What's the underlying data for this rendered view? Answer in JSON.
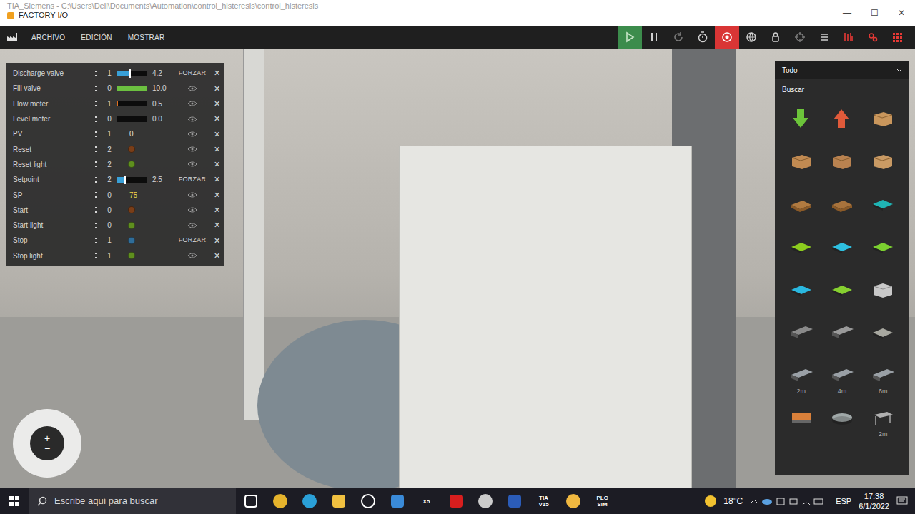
{
  "window": {
    "path": "TIA_Siemens - C:\\Users\\Dell\\Documents\\Automation\\control_histeresis\\control_histeresis",
    "title": "FACTORY I/O",
    "controls": [
      "—",
      "☐",
      "✕"
    ]
  },
  "menu": [
    "ARCHIVO",
    "EDICIÓN",
    "MOSTRAR"
  ],
  "toolbar": [
    {
      "kind": "play",
      "active": true,
      "color": "#c8e6c9"
    },
    {
      "kind": "pause",
      "active": false,
      "color": "#d0d0d0"
    },
    {
      "kind": "reset",
      "active": false,
      "color": "#7a7a7a"
    },
    {
      "kind": "timer",
      "active": false,
      "color": "#d0d0d0"
    },
    {
      "kind": "camera",
      "active": true,
      "color": "#ffffff"
    },
    {
      "kind": "globe",
      "active": false,
      "color": "#d0d0d0"
    },
    {
      "kind": "lock",
      "active": false,
      "color": "#d0d0d0"
    },
    {
      "kind": "target",
      "active": false,
      "color": "#7a7a7a"
    },
    {
      "kind": "list",
      "active": false,
      "color": "#d0d0d0"
    },
    {
      "kind": "sensors",
      "active": false,
      "color": "#e53935"
    },
    {
      "kind": "gears",
      "active": false,
      "color": "#e53935"
    },
    {
      "kind": "grid",
      "active": false,
      "color": "#e53935"
    }
  ],
  "tags": [
    {
      "name": "Discharge valve",
      "value": "1",
      "kind": "slider",
      "level": 0.42,
      "reading": "4.2",
      "action": {
        "kind": "force",
        "label": "FORZAR"
      },
      "remove": "✕"
    },
    {
      "name": "Fill valve",
      "value": "0",
      "kind": "bar",
      "level": 1.0,
      "reading": "10.0",
      "color": "#6cc040",
      "action": {
        "kind": "view"
      },
      "remove": "✕"
    },
    {
      "name": "Flow meter",
      "value": "1",
      "kind": "bar",
      "level": 0.05,
      "reading": "0.5",
      "color": "#e07020",
      "action": {
        "kind": "view"
      },
      "remove": "✕"
    },
    {
      "name": "Level meter",
      "value": "0",
      "kind": "bar",
      "level": 0.0,
      "reading": "0.0",
      "color": "#e07020",
      "action": {
        "kind": "view"
      },
      "remove": "✕"
    },
    {
      "name": "PV",
      "value": "1",
      "kind": "number",
      "reading": "0",
      "color": "#e0e0e0",
      "action": {
        "kind": "view"
      },
      "remove": "✕"
    },
    {
      "name": "Reset",
      "value": "2",
      "kind": "dot",
      "color": "#7a3e18",
      "action": {
        "kind": "view"
      },
      "remove": "✕"
    },
    {
      "name": "Reset light",
      "value": "2",
      "kind": "dot",
      "color": "#5f8f1e",
      "action": {
        "kind": "view"
      },
      "remove": "✕"
    },
    {
      "name": "Setpoint",
      "value": "2",
      "kind": "slider",
      "level": 0.25,
      "reading": "2.5",
      "action": {
        "kind": "force",
        "label": "FORZAR"
      },
      "remove": "✕"
    },
    {
      "name": "SP",
      "value": "0",
      "kind": "number",
      "reading": "75",
      "color": "#e8d44a",
      "action": {
        "kind": "view"
      },
      "remove": "✕"
    },
    {
      "name": "Start",
      "value": "0",
      "kind": "dot",
      "color": "#7a3e18",
      "action": {
        "kind": "view"
      },
      "remove": "✕"
    },
    {
      "name": "Start light",
      "value": "0",
      "kind": "dot",
      "color": "#5f8f1e",
      "action": {
        "kind": "view"
      },
      "remove": "✕"
    },
    {
      "name": "Stop",
      "value": "1",
      "kind": "dot",
      "color": "#2f6d99",
      "action": {
        "kind": "force",
        "label": "FORZAR"
      },
      "remove": "✕"
    },
    {
      "name": "Stop light",
      "value": "1",
      "kind": "dot",
      "color": "#5f8f1e",
      "action": {
        "kind": "view"
      },
      "remove": "✕"
    }
  ],
  "nav": {
    "plus": "+",
    "minus": "−"
  },
  "library": {
    "filter": "Todo",
    "search": "Buscar",
    "items": [
      {
        "kind": "arrow-down",
        "color": "#6cc43a"
      },
      {
        "kind": "arrow-up",
        "color": "#e05a3a"
      },
      {
        "kind": "box",
        "color": "#c9965c"
      },
      {
        "kind": "box",
        "color": "#c18a52"
      },
      {
        "kind": "box",
        "color": "#b98250"
      },
      {
        "kind": "box",
        "color": "#c99a64"
      },
      {
        "kind": "pallet",
        "color": "#b07a40"
      },
      {
        "kind": "pallet",
        "color": "#a8733c"
      },
      {
        "kind": "plate",
        "color": "#1fb3b3"
      },
      {
        "kind": "plate",
        "color": "#8ccc1e"
      },
      {
        "kind": "plate",
        "color": "#2ec0e0"
      },
      {
        "kind": "plate",
        "color": "#7cd030"
      },
      {
        "kind": "plate",
        "color": "#2ab8e0"
      },
      {
        "kind": "plate",
        "color": "#86d030"
      },
      {
        "kind": "bin",
        "color": "#c8c8c8"
      },
      {
        "kind": "conveyor",
        "color": "#8a8a8a"
      },
      {
        "kind": "conveyor",
        "color": "#9a9a9a"
      },
      {
        "kind": "plate",
        "color": "#a8a8a0"
      },
      {
        "kind": "roller",
        "color": "#9aa0a6",
        "label": "2m"
      },
      {
        "kind": "roller",
        "color": "#9aa0a6",
        "label": "4m"
      },
      {
        "kind": "roller",
        "color": "#9aa0a6",
        "label": "6m"
      },
      {
        "kind": "block",
        "color": "#d9803a"
      },
      {
        "kind": "turntable",
        "color": "#a0a8a8"
      },
      {
        "kind": "table",
        "color": "#b0b0b0",
        "label": "2m"
      }
    ]
  },
  "taskbar": {
    "search": "Escribe aquí para buscar",
    "apps": [
      {
        "kind": "taskview",
        "color": "#ffffff"
      },
      {
        "kind": "chrome",
        "color": "#e5b32c"
      },
      {
        "kind": "edge",
        "color": "#2aa0d8"
      },
      {
        "kind": "folder",
        "color": "#f0c040"
      },
      {
        "kind": "dell",
        "color": "#ffffff"
      },
      {
        "kind": "mail",
        "color": "#3a8ad8"
      },
      {
        "kind": "label",
        "color": "#ffffff",
        "label": "X5"
      },
      {
        "kind": "acrobat",
        "color": "#d81e1e"
      },
      {
        "kind": "circle",
        "color": "#cccccc"
      },
      {
        "kind": "word",
        "color": "#2b5cb8"
      },
      {
        "kind": "label",
        "color": "#ffffff",
        "label": "TIA V15"
      },
      {
        "kind": "factory",
        "color": "#f0b840"
      },
      {
        "kind": "label",
        "color": "#ffffff",
        "label": "PLC SIM"
      }
    ],
    "weather": "18°C",
    "language": "ESP",
    "time": "17:38",
    "date": "6/1/2022"
  }
}
